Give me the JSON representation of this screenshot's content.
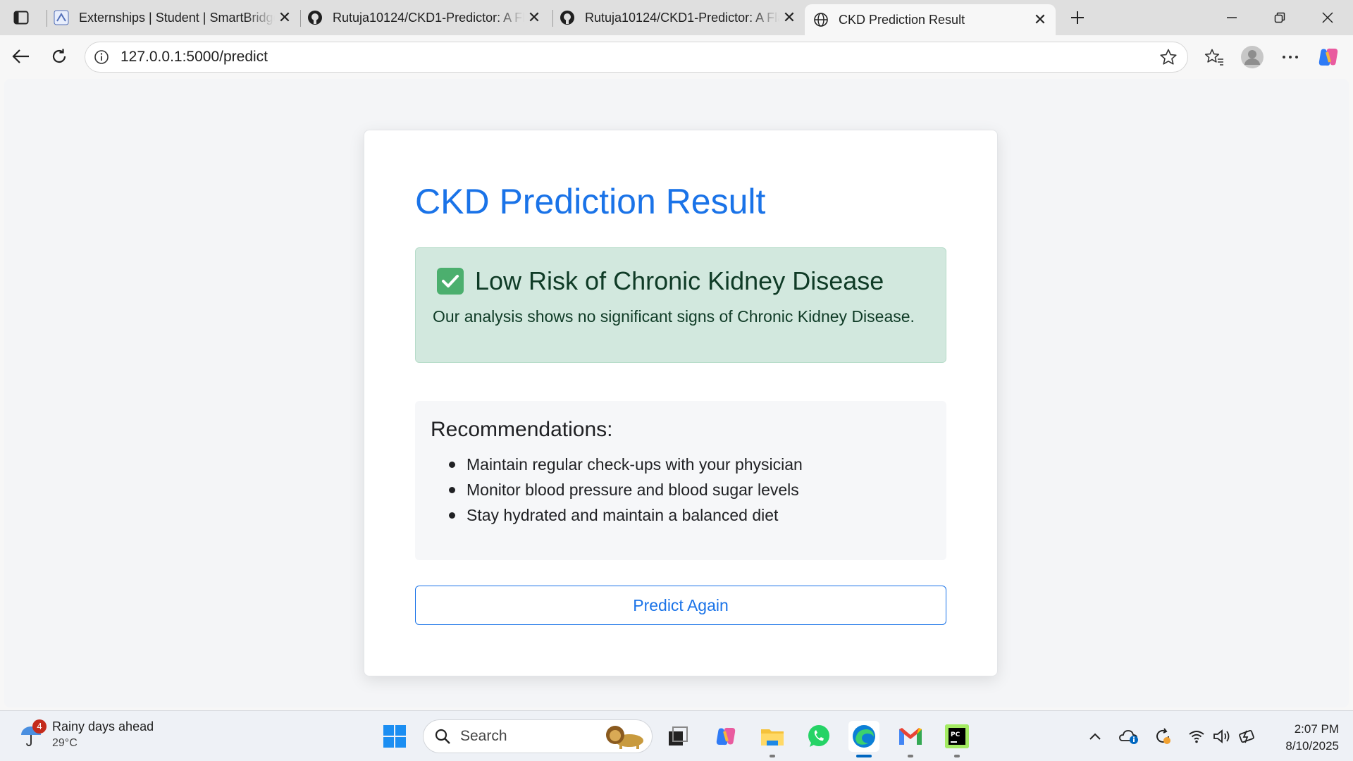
{
  "browser": {
    "tabs": [
      {
        "title": "Externships | Student | SmartBridge",
        "favicon": "smartbridge-icon",
        "active": false
      },
      {
        "title": "Rutuja10124/CKD1-Predictor: A Flask",
        "favicon": "github-icon",
        "active": false
      },
      {
        "title": "Rutuja10124/CKD1-Predictor: A Flask",
        "favicon": "github-icon",
        "active": false
      },
      {
        "title": "CKD Prediction Result",
        "favicon": "globe-icon",
        "active": true
      }
    ],
    "url": "127.0.0.1:5000/predict"
  },
  "page": {
    "title": "CKD Prediction Result",
    "result": {
      "status": "success",
      "heading": "Low Risk of Chronic Kidney Disease",
      "message": "Our analysis shows no significant signs of Chronic Kidney Disease."
    },
    "recommendations": {
      "heading": "Recommendations:",
      "items": [
        "Maintain regular check-ups with your physician",
        "Monitor blood pressure and blood sugar levels",
        "Stay hydrated and maintain a balanced diet"
      ]
    },
    "predict_again_label": "Predict Again"
  },
  "taskbar": {
    "weather": {
      "text": "Rainy days ahead",
      "temp": "29°C",
      "badge": "4"
    },
    "search_placeholder": "Search",
    "apps": [
      "start-icon",
      "search",
      "task-view-icon",
      "copilot-icon",
      "file-explorer-icon",
      "whatsapp-icon",
      "edge-icon",
      "gmail-icon",
      "pycharm-icon"
    ],
    "clock": {
      "time": "2:07 PM",
      "date": "8/10/2025"
    }
  },
  "colors": {
    "accent": "#1a73e8",
    "success_bg": "#d2e8de",
    "success_text": "#0f3b26"
  }
}
